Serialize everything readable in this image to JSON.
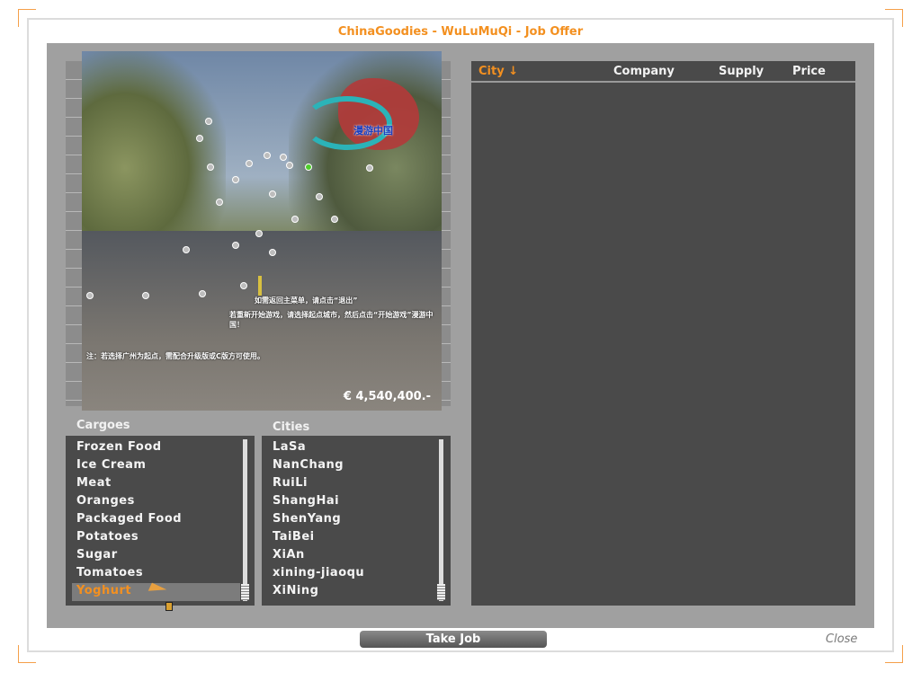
{
  "window": {
    "title": "ChinaGoodies - WuLuMuQi - Job Offer"
  },
  "map": {
    "logo_text": "漫游中国",
    "overlay_lines": [
      "如需返回主菜单，请点击“退出”",
      "若重新开始游戏，请选择起点城市，然后点击“开始游戏”漫游中国！",
      "注：若选择广州为起点，需配合升级版或C版方可使用。"
    ],
    "money": "€ 4,540,400.-"
  },
  "cargoes": {
    "label": "Cargoes",
    "items": [
      "Frozen Food",
      "Ice Cream",
      "Meat",
      "Oranges",
      "Packaged Food",
      "Potatoes",
      "Sugar",
      "Tomatoes",
      "Yoghurt"
    ],
    "selected": "Yoghurt"
  },
  "cities": {
    "label": "Cities",
    "items": [
      "LaSa",
      "NanChang",
      "RuiLi",
      "ShangHai",
      "ShenYang",
      "TaiBei",
      "XiAn",
      "xining-jiaoqu",
      "XiNing"
    ]
  },
  "table": {
    "columns": [
      "City ↓",
      "Company",
      "Supply",
      "Price"
    ],
    "rows": []
  },
  "buttons": {
    "take_job": "Take Job",
    "close": "Close"
  },
  "colors": {
    "accent": "#f39020",
    "panel": "#a0a0a0",
    "list_bg": "#4a4a4a"
  }
}
